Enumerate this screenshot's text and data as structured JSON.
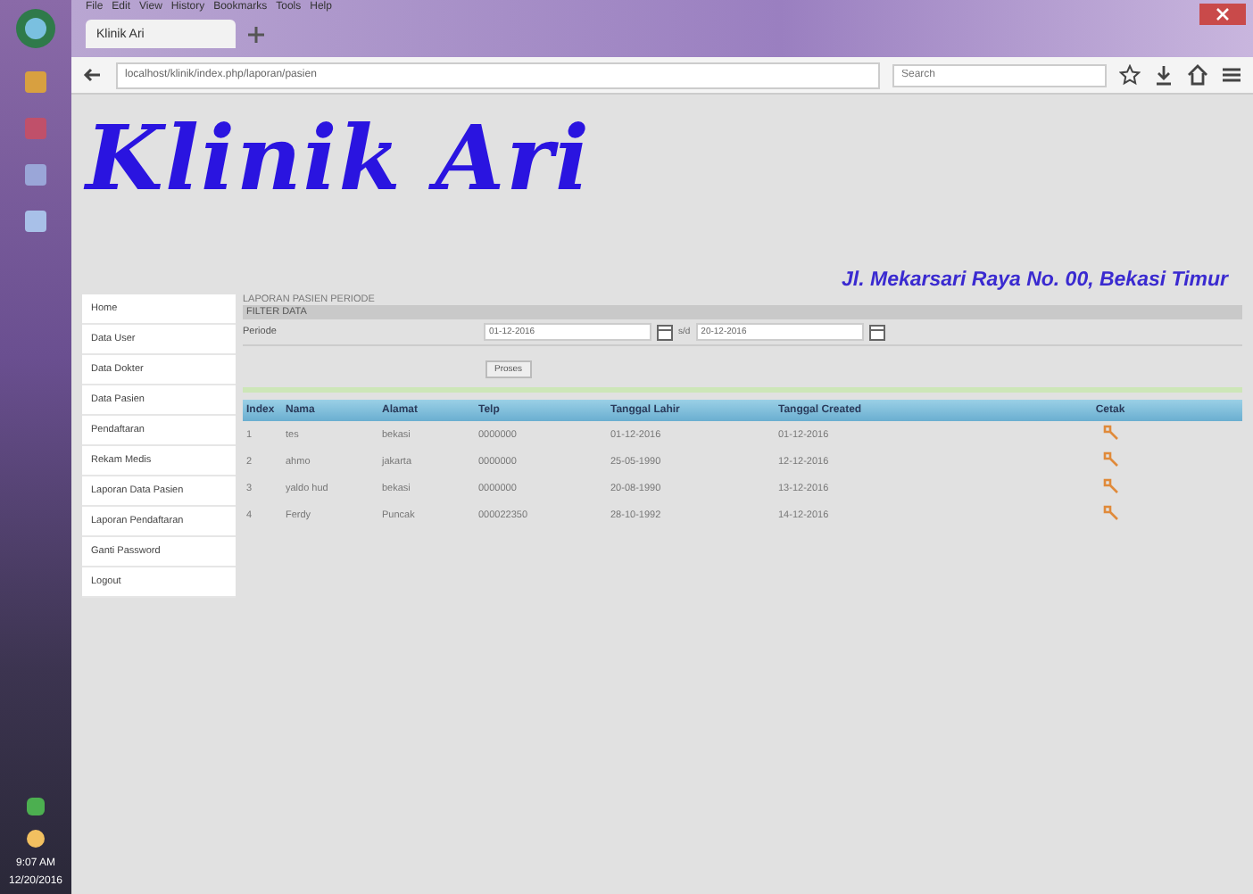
{
  "browser": {
    "menu": [
      "File",
      "Edit",
      "View",
      "History",
      "Bookmarks",
      "Tools",
      "Help"
    ],
    "tab_title": "Klinik Ari",
    "url": "localhost/klinik/index.php/laporan/pasien",
    "search": {
      "placeholder": "Search"
    }
  },
  "taskbar": {
    "clock": "9:07 AM",
    "date": "12/20/2016"
  },
  "header": {
    "logo": "Klinik Ari",
    "address": "Jl. Mekarsari Raya No. 00, Bekasi Timur"
  },
  "sidebar": {
    "items": [
      {
        "label": "Home"
      },
      {
        "label": "Data User"
      },
      {
        "label": "Data Dokter"
      },
      {
        "label": "Data Pasien"
      },
      {
        "label": "Pendaftaran"
      },
      {
        "label": "Rekam Medis"
      },
      {
        "label": "Laporan Data Pasien"
      },
      {
        "label": "Laporan Pendaftaran"
      },
      {
        "label": "Ganti Password"
      },
      {
        "label": "Logout"
      }
    ]
  },
  "report": {
    "title": "LAPORAN PASIEN PERIODE",
    "filter_title": "FILTER DATA",
    "period_label": "Periode",
    "date_from": "01-12-2016",
    "separator": "s/d",
    "date_to": "20-12-2016",
    "submit": "Proses"
  },
  "table": {
    "columns": [
      "Index",
      "Nama",
      "Alamat",
      "Telp",
      "Tanggal Lahir",
      "Tanggal Created",
      "Cetak"
    ],
    "rows": [
      {
        "cells": [
          "1",
          "tes",
          "bekasi",
          "0000000",
          "01-12-2016",
          "01-12-2016"
        ]
      },
      {
        "cells": [
          "2",
          "ahmo",
          "jakarta",
          "0000000",
          "25-05-1990",
          "12-12-2016"
        ]
      },
      {
        "cells": [
          "3",
          "yaldo hud",
          "bekasi",
          "0000000",
          "20-08-1990",
          "13-12-2016"
        ]
      },
      {
        "cells": [
          "4",
          "Ferdy",
          "Puncak",
          "000022350",
          "28-10-1992",
          "14-12-2016"
        ]
      }
    ]
  }
}
